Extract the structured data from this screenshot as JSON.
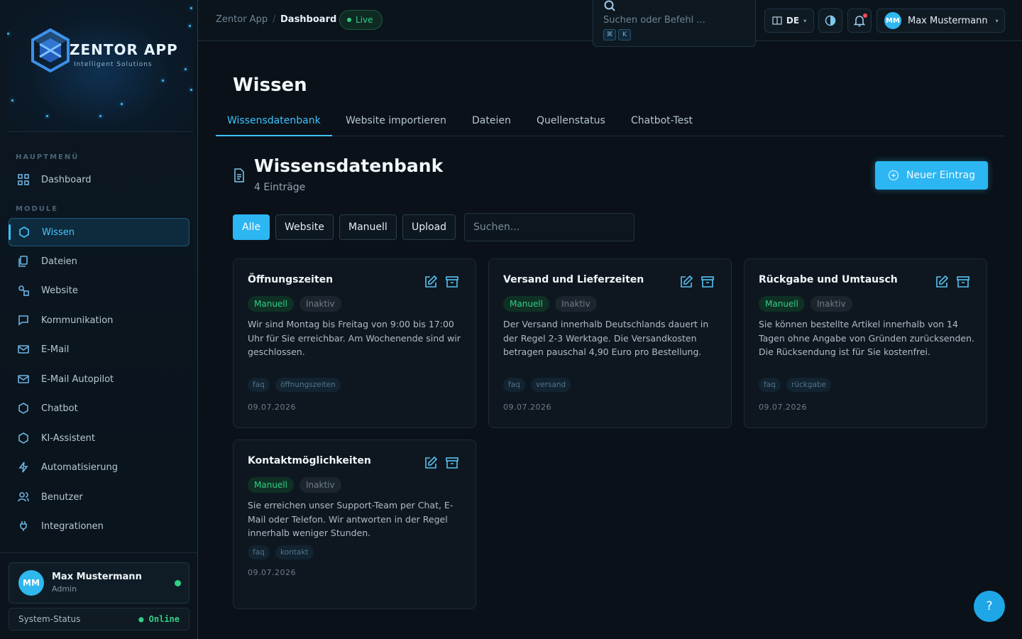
{
  "sidebar": {
    "brand": {
      "title": "ZENTOR APP",
      "subtitle": "Intelligent Solutions"
    },
    "section_main": "HAUPTMENÜ",
    "section_modules": "MODULE",
    "items": [
      {
        "label": "Dashboard",
        "icon": "grid-icon"
      },
      {
        "label": "Wissen",
        "icon": "hexagon-icon"
      },
      {
        "label": "Dateien",
        "icon": "files-icon"
      },
      {
        "label": "Website",
        "icon": "shapes-icon"
      },
      {
        "label": "Kommunikation",
        "icon": "message-icon"
      },
      {
        "label": "E-Mail",
        "icon": "mail-icon"
      },
      {
        "label": "E-Mail Autopilot",
        "icon": "mail-icon"
      },
      {
        "label": "Chatbot",
        "icon": "hexagon-icon"
      },
      {
        "label": "KI-Assistent",
        "icon": "hexagon-icon"
      },
      {
        "label": "Automatisierung",
        "icon": "bolt-icon"
      },
      {
        "label": "Benutzer",
        "icon": "users-icon"
      },
      {
        "label": "Integrationen",
        "icon": "plug-icon"
      }
    ],
    "user": {
      "initials": "MM",
      "name": "Max Mustermann",
      "role": "Admin"
    },
    "status": {
      "label": "System-Status",
      "value": "Online"
    }
  },
  "topbar": {
    "breadcrumb": [
      "Zentor App",
      "/",
      "Dashboard"
    ],
    "live": "Live",
    "search": {
      "placeholder": "Suchen oder Befehl ...",
      "keys": [
        "⌘",
        "K"
      ]
    },
    "language": "DE",
    "user": {
      "initials": "MM",
      "name": "Max Mustermann"
    }
  },
  "main": {
    "page_title": "Wissen",
    "tabs": [
      "Wissensdatenbank",
      "Website importieren",
      "Dateien",
      "Quellenstatus",
      "Chatbot-Test"
    ],
    "section_title": "Wissensdatenbank",
    "section_count": "4 Einträge",
    "new_button": "Neuer Eintrag",
    "filters": [
      "Alle",
      "Website",
      "Manuell",
      "Upload"
    ],
    "search_placeholder": "Suchen...",
    "cards": [
      {
        "title": "Öffnungszeiten",
        "type": "Manuell",
        "status": "Inaktiv",
        "text": "Wir sind Montag bis Freitag von 9:00 bis 17:00 Uhr für Sie erreichbar. Am Wochenende sind wir geschlossen.",
        "tags": [
          "faq",
          "öffnungszeiten"
        ],
        "date": "09.07.2026"
      },
      {
        "title": "Versand und Lieferzeiten",
        "type": "Manuell",
        "status": "Inaktiv",
        "text": "Der Versand innerhalb Deutschlands dauert in der Regel 2-3 Werktage. Die Versandkosten betragen pauschal 4,90 Euro pro Bestellung.",
        "tags": [
          "faq",
          "versand"
        ],
        "date": "09.07.2026"
      },
      {
        "title": "Rückgabe und Umtausch",
        "type": "Manuell",
        "status": "Inaktiv",
        "text": "Sie können bestellte Artikel innerhalb von 14 Tagen ohne Angabe von Gründen zurücksenden. Die Rücksendung ist für Sie kostenfrei.",
        "tags": [
          "faq",
          "rückgabe"
        ],
        "date": "09.07.2026"
      },
      {
        "title": "Kontaktmöglichkeiten",
        "type": "Manuell",
        "status": "Inaktiv",
        "text": "Sie erreichen unser Support-Team per Chat, E-Mail oder Telefon. Wir antworten in der Regel innerhalb weniger Stunden.",
        "tags": [
          "faq",
          "kontakt"
        ],
        "date": "09.07.2026"
      }
    ],
    "help": "?"
  },
  "colors": {
    "accent": "#2cb6f2",
    "success": "#2ecf86",
    "background": "#0a1118"
  }
}
